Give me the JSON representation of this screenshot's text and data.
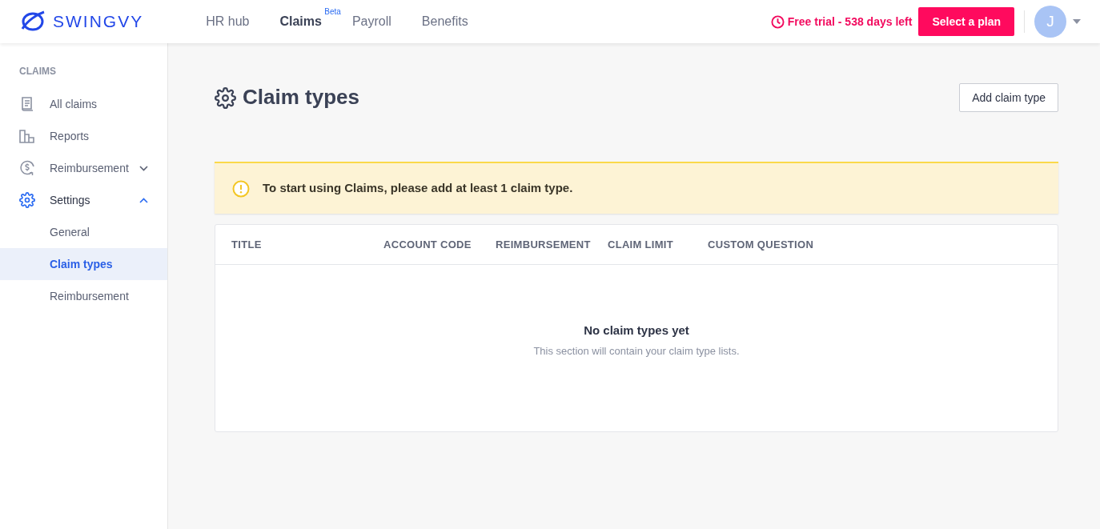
{
  "brand": {
    "name": "SWINGVY"
  },
  "nav": [
    {
      "label": "HR hub",
      "selected": false
    },
    {
      "label": "Claims",
      "selected": true,
      "badge": "Beta"
    },
    {
      "label": "Payroll",
      "selected": false
    },
    {
      "label": "Benefits",
      "selected": false
    }
  ],
  "trial": {
    "text": "Free trial - 538 days left"
  },
  "plan_button": "Select a plan",
  "avatar": {
    "initial": "J"
  },
  "sidebar": {
    "heading": "CLAIMS",
    "items": [
      {
        "label": "All claims",
        "selected": false
      },
      {
        "label": "Reports",
        "selected": false
      },
      {
        "label": "Reimbursement",
        "selected": false,
        "expanded": false
      },
      {
        "label": "Settings",
        "selected": true,
        "expanded": true,
        "children": [
          {
            "label": "General",
            "selected": false
          },
          {
            "label": "Claim types",
            "selected": true
          },
          {
            "label": "Reimbursement",
            "selected": false
          }
        ]
      }
    ]
  },
  "page": {
    "title": "Claim types",
    "add_button": "Add claim type"
  },
  "alert": {
    "text": "To start using Claims, please add at least 1 claim type."
  },
  "table": {
    "columns": [
      "TITLE",
      "ACCOUNT CODE",
      "REIMBURSEMENT",
      "CLAIM LIMIT",
      "CUSTOM QUESTION"
    ],
    "empty_title": "No claim types yet",
    "empty_text": "This section will contain your claim type lists."
  }
}
